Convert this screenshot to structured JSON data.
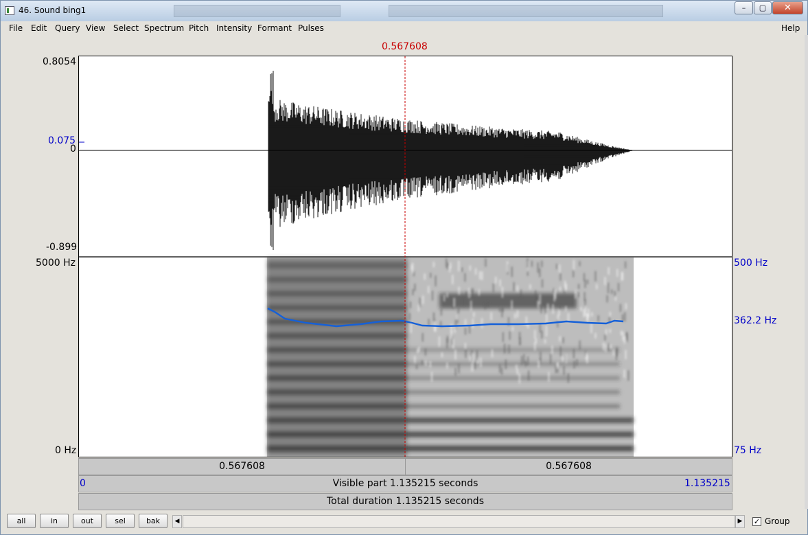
{
  "window": {
    "title": "46. Sound bing1",
    "buttons": {
      "minimize": "–",
      "restore": "▢",
      "close": "✕"
    }
  },
  "menu": [
    "File",
    "Edit",
    "Query",
    "View",
    "Select",
    "Spectrum",
    "Pitch",
    "Intensity",
    "Formant",
    "Pulses",
    "Help"
  ],
  "cursor": {
    "time_label": "0.567608",
    "time": 0.567608,
    "color": "#c80000"
  },
  "waveform": {
    "max_label": "0.8054",
    "zero_label": "0",
    "cursor_value_label": "0.075",
    "min_label": "-0.899",
    "max": 0.8054,
    "min": -0.899
  },
  "spectrogram": {
    "top_label": "5000 Hz",
    "bottom_label": "0 Hz"
  },
  "pitch": {
    "top_label": "500 Hz",
    "value_label": "362.2 Hz",
    "bottom_label": "75 Hz",
    "color": "#1560d8"
  },
  "time_bars": {
    "left_segment": "0.567608",
    "right_segment": "0.567608",
    "visible_start": "0",
    "visible_part": "Visible part 1.135215 seconds",
    "visible_end": "1.135215",
    "total_duration": "Total duration 1.135215 seconds"
  },
  "buttons": [
    "all",
    "in",
    "out",
    "sel",
    "bak"
  ],
  "group": {
    "label": "Group",
    "checked": "✓"
  }
}
